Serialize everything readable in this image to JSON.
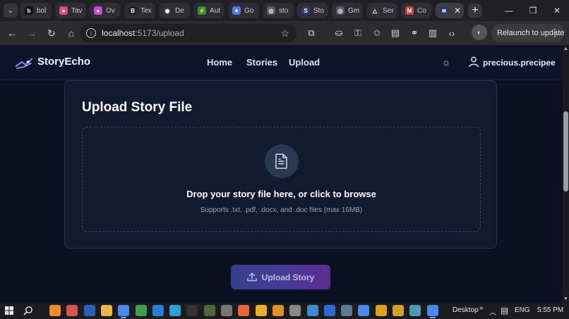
{
  "browser": {
    "tabs": [
      {
        "label": "bol",
        "color": "#111111",
        "glyph": "b"
      },
      {
        "label": "Tav",
        "color": "#d94a8c",
        "glyph": "●"
      },
      {
        "label": "Ov",
        "color": "#c14ed0",
        "glyph": "●"
      },
      {
        "label": "Tex",
        "color": "#222222",
        "glyph": "B"
      },
      {
        "label": "De",
        "color": "#333333",
        "glyph": "◉"
      },
      {
        "label": "Aut",
        "color": "#2f8f3f",
        "glyph": "⚡"
      },
      {
        "label": "Go",
        "color": "#4a7fe8",
        "glyph": "✦"
      },
      {
        "label": "sto",
        "color": "#5a5a62",
        "glyph": "◎"
      },
      {
        "label": "Sto",
        "color": "#2d3b6a",
        "glyph": "S"
      },
      {
        "label": "Gm",
        "color": "#5a5a62",
        "glyph": "◎"
      },
      {
        "label": "Ser",
        "color": "#333333",
        "glyph": "△"
      },
      {
        "label": "Co",
        "color": "#c6453b",
        "glyph": "M"
      }
    ],
    "active_tab_glyph": "≋",
    "new_tab": "+",
    "window_controls": {
      "minimize": "—",
      "restore": "❐",
      "close": "✕"
    },
    "url_host": "localhost",
    "url_rest": ":5173/upload",
    "relaunch_label": "Relaunch to update"
  },
  "site": {
    "brand": "StoryEcho",
    "nav": {
      "home": "Home",
      "stories": "Stories",
      "upload": "Upload"
    },
    "username": "precious.precipee"
  },
  "upload": {
    "title": "Upload Story File",
    "drop_title": "Drop your story file here, or click to browse",
    "drop_hint": "Supports .txt, .pdf, .docx, and .doc files (max 16MB)",
    "button_label": "Upload Story"
  },
  "taskbar": {
    "desktop_label": "Desktop",
    "chevron": "»",
    "language": "ENG",
    "time": "5:55 PM",
    "apps": [
      {
        "color": "#f08a2c"
      },
      {
        "color": "#d9534f"
      },
      {
        "color": "#2b5fb8"
      },
      {
        "color": "#e8b84a"
      },
      {
        "color": "#4a8af0",
        "active": true
      },
      {
        "color": "#3f9f4f"
      },
      {
        "color": "#2a7fd4"
      },
      {
        "color": "#2a9fd4"
      },
      {
        "color": "#333333"
      },
      {
        "color": "#4a6a3a"
      },
      {
        "color": "#777777"
      },
      {
        "color": "#e8643a"
      },
      {
        "color": "#e8b02a"
      },
      {
        "color": "#e0902a"
      },
      {
        "color": "#888888"
      },
      {
        "color": "#3a8ad4"
      },
      {
        "color": "#2a6ad4"
      },
      {
        "color": "#5a7a9a"
      },
      {
        "color": "#4a8af0"
      },
      {
        "color": "#e0a020"
      },
      {
        "color": "#d4a02a"
      },
      {
        "color": "#4a9ab8"
      },
      {
        "color": "#4a8af0",
        "active": true
      }
    ]
  }
}
